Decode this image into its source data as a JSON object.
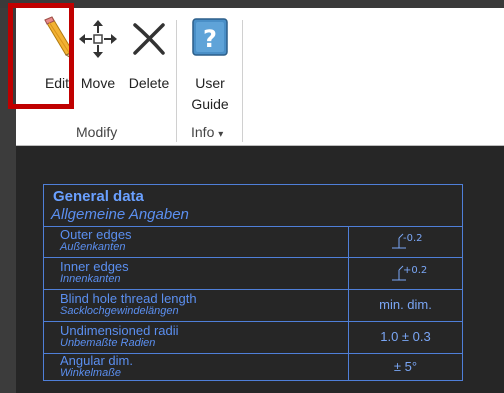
{
  "ribbon": {
    "edit_label": "Edit",
    "move_label": "Move",
    "delete_label": "Delete",
    "user_guide_label_line1": "User",
    "user_guide_label_line2": "Guide",
    "group_modify": "Modify",
    "group_info": "Info",
    "info_caret": "▾"
  },
  "table": {
    "title_en": "General data",
    "title_de": "Allgemeine Angaben",
    "rows": [
      {
        "en": "Outer edges",
        "de": "Außenkanten",
        "value": "-0.2"
      },
      {
        "en": "Inner edges",
        "de": "Innenkanten",
        "value": "+0.2"
      },
      {
        "en": "Blind hole thread length",
        "de": "Sacklochgewindelängen",
        "value": "min. dim."
      },
      {
        "en": "Undimensioned radii",
        "de": "Unbemaßte Radien",
        "value": "1.0 ± 0.3"
      },
      {
        "en": "Angular dim.",
        "de": "Winkelmaße",
        "value": "± 5°"
      }
    ]
  },
  "colors": {
    "highlight": "#c00000",
    "table_line": "#4f7fd8",
    "table_text": "#5b8ff0"
  }
}
